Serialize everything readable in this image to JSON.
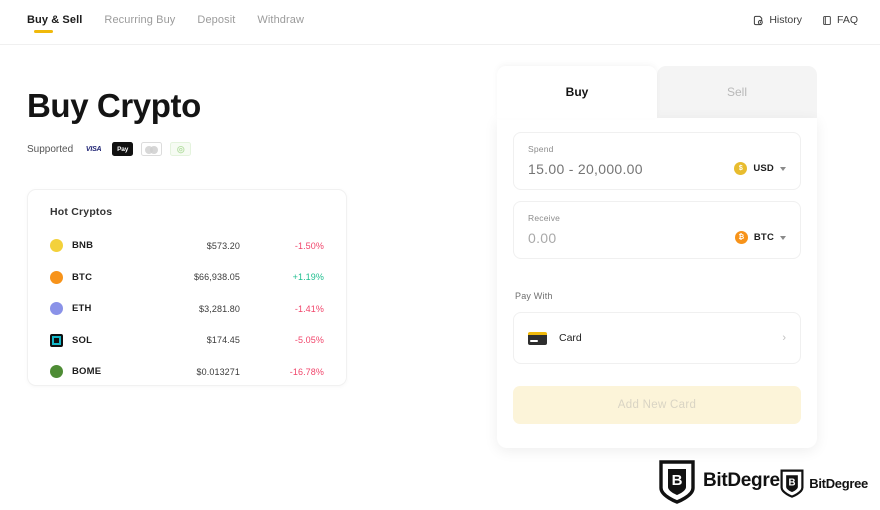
{
  "nav": {
    "items": [
      {
        "label": "Buy & Sell",
        "active": true
      },
      {
        "label": "Recurring Buy",
        "active": false
      },
      {
        "label": "Deposit",
        "active": false
      },
      {
        "label": "Withdraw",
        "active": false
      }
    ],
    "right": [
      {
        "label": "History",
        "icon": "history-icon"
      },
      {
        "label": "FAQ",
        "icon": "book-icon"
      }
    ],
    "accent_color": "#f0b90b"
  },
  "hero": {
    "title": "Buy Crypto",
    "supported_label": "Supported",
    "payment_icons": [
      {
        "name": "visa-icon",
        "text": "VISA"
      },
      {
        "name": "apple-pay-icon",
        "text": "Pay"
      },
      {
        "name": "mastercard-icon",
        "text": ""
      },
      {
        "name": "green-payment-icon",
        "text": "◎"
      }
    ]
  },
  "hot_cryptos": {
    "title": "Hot Cryptos",
    "rows": [
      {
        "symbol": "BNB",
        "price": "$573.20",
        "change": "-1.50%",
        "direction": "down",
        "color": "#f3d13b",
        "shape": "circle",
        "glyph": "⬢"
      },
      {
        "symbol": "BTC",
        "price": "$66,938.05",
        "change": "+1.19%",
        "direction": "up",
        "color": "#f7931a",
        "shape": "circle",
        "glyph": "₿"
      },
      {
        "symbol": "ETH",
        "price": "$3,281.80",
        "change": "-1.41%",
        "direction": "down",
        "color": "#8a92e8",
        "shape": "circle",
        "glyph": "◆"
      },
      {
        "symbol": "SOL",
        "price": "$174.45",
        "change": "-5.05%",
        "direction": "down",
        "color": "#14f195",
        "shape": "square",
        "glyph": ""
      },
      {
        "symbol": "BOME",
        "price": "$0.013271",
        "change": "-16.78%",
        "direction": "down",
        "color": "#4e8c35",
        "shape": "circle",
        "glyph": ""
      }
    ],
    "up_color": "#1fbf8f",
    "down_color": "#f1456b"
  },
  "widget": {
    "tabs": [
      {
        "label": "Buy",
        "active": true
      },
      {
        "label": "Sell",
        "active": false
      }
    ],
    "spend": {
      "label": "Spend",
      "placeholder": "15.00 - 20,000.00",
      "value": "",
      "currency": "USD",
      "currency_color": "#e8bc2e"
    },
    "receive": {
      "label": "Receive",
      "value": "0.00",
      "currency": "BTC",
      "currency_color": "#f7931a"
    },
    "pay_with": {
      "label": "Pay With",
      "option_label": "Card",
      "option_icon": "credit-card-icon",
      "chevron": "›"
    },
    "add_card_button": "Add New Card"
  },
  "watermark": {
    "big_text": "BitDegree",
    "small_text": "BitDegree"
  }
}
